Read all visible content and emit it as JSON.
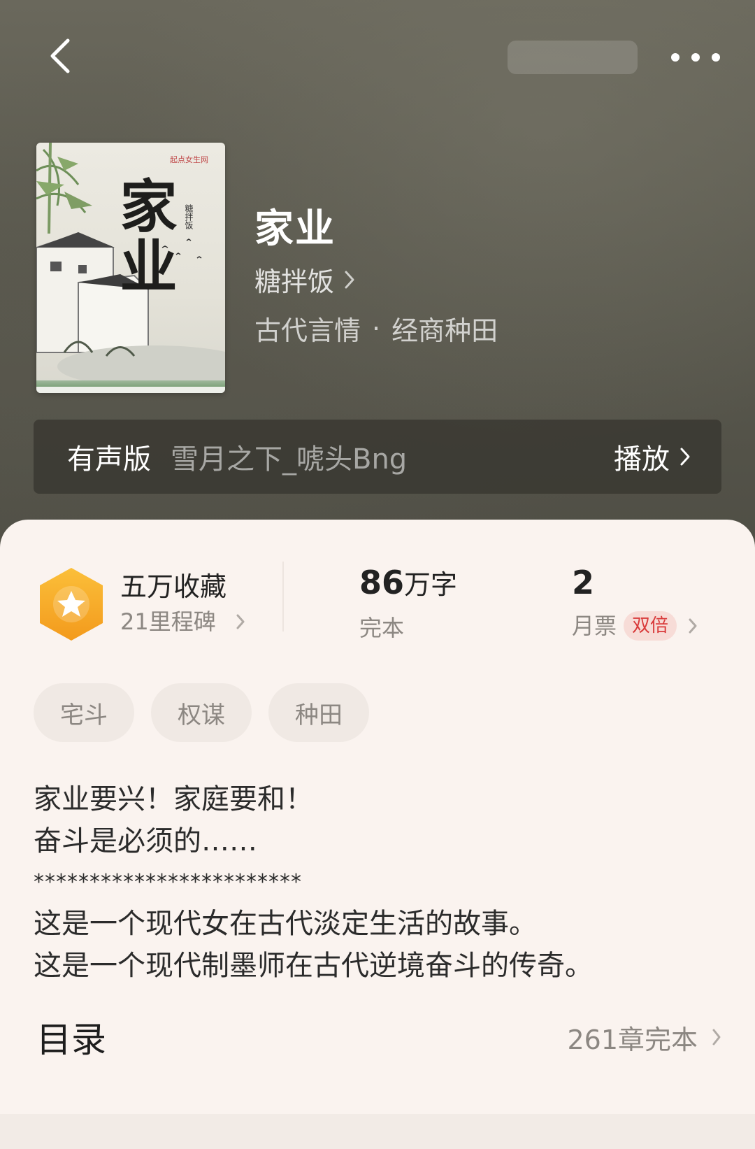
{
  "header": {
    "back_icon": "back-arrow-icon",
    "more_icon": "more-dots-icon"
  },
  "book": {
    "title": "家业",
    "author": "糖拌饭",
    "category": "古代言情",
    "category_separator": "·",
    "subcategory": "经商种田",
    "cover": {
      "title": "家业",
      "publisher": "起点女生网",
      "author": "糖拌饭"
    }
  },
  "audio": {
    "label": "有声版",
    "narrator": "雪月之下_唬头Bng",
    "play_label": "播放"
  },
  "stats": {
    "favorites": "五万收藏",
    "milestone": "21里程碑",
    "word_count_number": "86",
    "word_count_unit": "万字",
    "completion_status": "完本",
    "monthly_tickets": "2",
    "monthly_tickets_label": "月票",
    "double_badge": "双倍"
  },
  "tags": [
    "宅斗",
    "权谋",
    "种田"
  ],
  "intro": {
    "line1": "家业要兴！家庭要和！",
    "line2": "奋斗是必须的……",
    "stars": "************************",
    "line3": "这是一个现代女在古代淡定生活的故事。",
    "line4": "这是一个现代制墨师在古代逆境奋斗的传奇。"
  },
  "toc": {
    "title": "目录",
    "chapter_info": "261章完本"
  },
  "colors": {
    "accent_red": "#d93a3a",
    "badge_orange": "#f5a623",
    "card_background": "#faf3ef"
  }
}
